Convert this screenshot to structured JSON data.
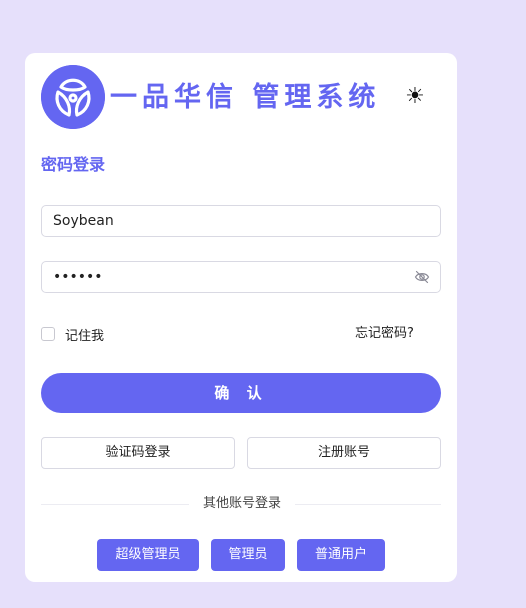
{
  "header": {
    "brand_title": "一品华信 管理系统",
    "logo_icon": "brand-logo-icon",
    "theme_icon": "sun-icon",
    "theme_glyph": "☀"
  },
  "login": {
    "section_title": "密码登录",
    "username_value": "Soybean",
    "password_value": "••••••",
    "password_icon": "eye-off-icon",
    "remember_label": "记住我",
    "forgot_label": "忘记密码?",
    "confirm_label": "确 认",
    "code_login_label": "验证码登录",
    "register_label": "注册账号",
    "other_title": "其他账号登录"
  },
  "roles": [
    {
      "label": "超级管理员"
    },
    {
      "label": "管理员"
    },
    {
      "label": "普通用户"
    }
  ],
  "colors": {
    "primary": "#6466f1",
    "page_background": "#e6e0fb",
    "card_background": "#ffffff"
  }
}
